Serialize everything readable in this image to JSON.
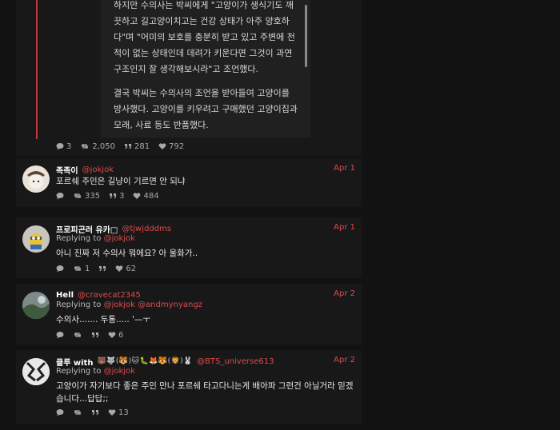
{
  "article": {
    "paragraphs": [
      "하지만 수의사는 박씨에게 \"고양이가 생식기도 깨끗하고 길고양이치고는 건강 상태가 아주 양호하다\"며 \"어미의 보호를 충분히 받고 있고 주변에 천적이 없는 상태인데 데려가 키운다면 그것이 과연 구조인지 잘 생각해보시라\"고 조언했다.",
      "결국 박씨는 수의사의 조언을 받아들여 고양이를 방사했다. 고양이를 키우려고 구매했던 고양이집과 모래, 사료 등도 반품했다."
    ]
  },
  "top_stats": {
    "replies": "3",
    "retweets": "2,050",
    "quotes": "281",
    "likes": "792"
  },
  "tweets": [
    {
      "name": "족족이",
      "handle": "@jokjok",
      "date": "Apr 1",
      "reply_label": "",
      "reply_to": "",
      "body": "포르쉐 주인은 길냥이 기르면 안 되냐",
      "stats": {
        "replies": "",
        "retweets": "335",
        "quotes": "3",
        "likes": "484"
      }
    },
    {
      "name": "프로피곤러 유카□",
      "handle": "@tjwjdddms",
      "date": "Apr 1",
      "reply_label": "Replying to",
      "reply_to": "@jokjok",
      "body": "아니 진짜 저 수의사 뭐에요? 아 울화가..",
      "stats": {
        "replies": "",
        "retweets": "1",
        "quotes": "",
        "likes": "62"
      }
    },
    {
      "name": "Hell",
      "handle": "@cravecat2345",
      "date": "Apr 2",
      "reply_label": "Replying to",
      "reply_to": "@jokjok @andmynyangz",
      "body": "수의사....... 두통..... '—ㅜ",
      "stats": {
        "replies": "",
        "retweets": "",
        "quotes": "",
        "likes": "6"
      }
    },
    {
      "name": "클루 with",
      "emoji": "🐻🐺(🐯)🐱🐛🦊🐯(🦁)🐰",
      "handle": "@BTS_universe613",
      "date": "Apr 2",
      "reply_label": "Replying to",
      "reply_to": "@jokjok",
      "body": "고양이가 자기보다 좋은 주인 만나 포르쉐 타고다니는게 배아파 그런건 아닐거라 믿겠습니다...답답;;",
      "stats": {
        "replies": "",
        "retweets": "",
        "quotes": "",
        "likes": "13"
      }
    }
  ],
  "colors": {
    "accent": "#e0494b",
    "thread_line": "#c0393b",
    "background": "#121212",
    "card": "#181818"
  },
  "icons": [
    "reply-icon",
    "retweet-icon",
    "quote-icon",
    "like-icon"
  ]
}
